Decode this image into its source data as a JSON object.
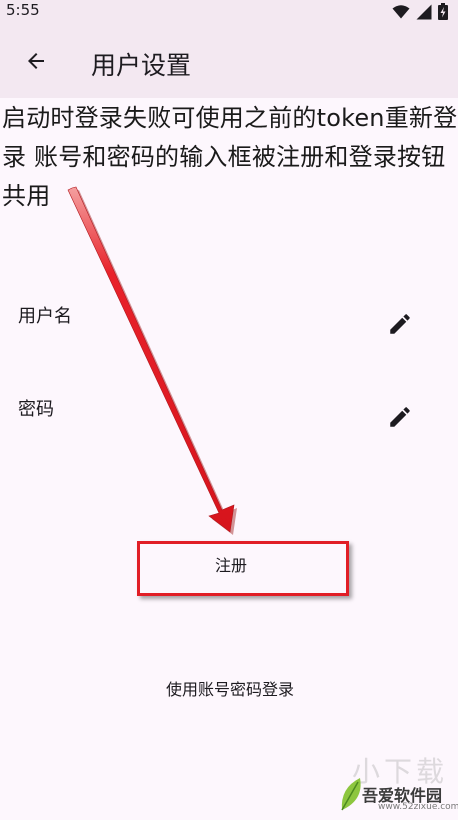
{
  "status_bar": {
    "time": "5:55"
  },
  "app_bar": {
    "title": "用户设置"
  },
  "annotation": {
    "text": "启动时登录失败可使用之前的token重新登录 账号和密码的输入框被注册和登录按钮共用"
  },
  "settings": {
    "username_label": "用户名",
    "password_label": "密码"
  },
  "actions": {
    "register_label": "注册",
    "login_label": "使用账号密码登录"
  },
  "colors": {
    "accent_red": "#e11e26",
    "app_bar_bg": "#f3e8f1",
    "page_bg": "#fdf7fd"
  },
  "icons": {
    "back": "arrow-back-icon",
    "edit": "pencil-icon",
    "wifi": "wifi-icon",
    "signal": "signal-icon",
    "battery": "battery-icon"
  },
  "watermark": {
    "brand": "吾爱软件园",
    "url": "www.52zixue.com",
    "overlay": "小下载"
  }
}
